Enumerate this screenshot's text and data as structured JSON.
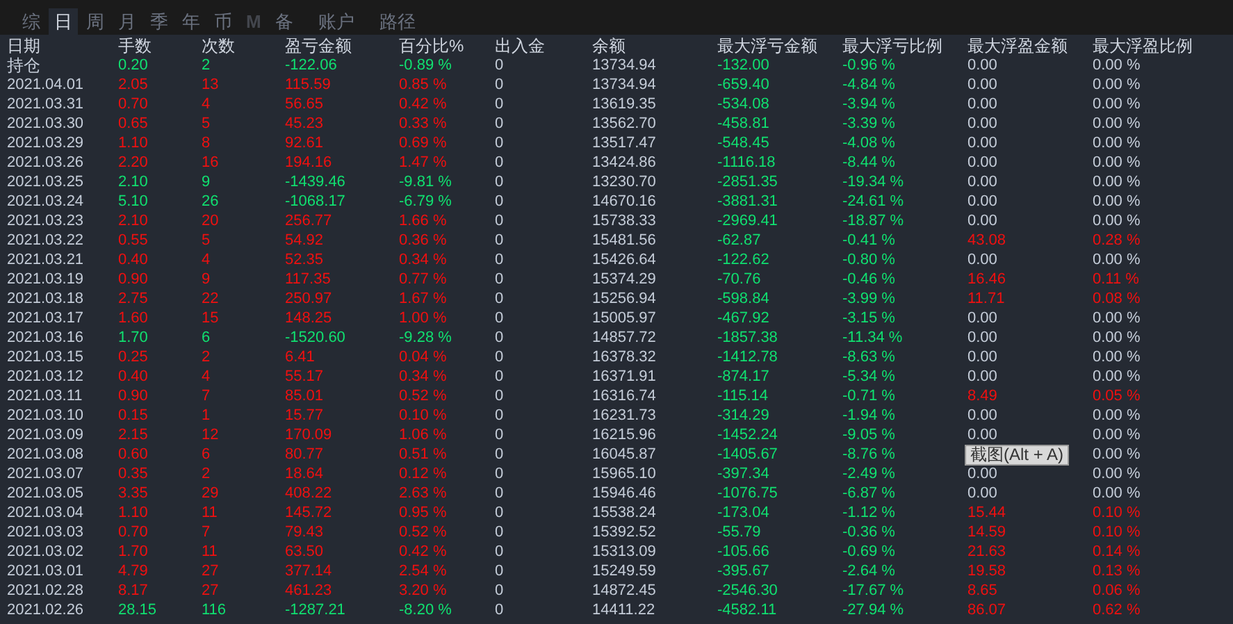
{
  "tabs": [
    {
      "label": "综",
      "selected": false,
      "disabled": false
    },
    {
      "label": "日",
      "selected": true,
      "disabled": false
    },
    {
      "label": "周",
      "selected": false,
      "disabled": false
    },
    {
      "label": "月",
      "selected": false,
      "disabled": false
    },
    {
      "label": "季",
      "selected": false,
      "disabled": false
    },
    {
      "label": "年",
      "selected": false,
      "disabled": false
    },
    {
      "label": "币",
      "selected": false,
      "disabled": false
    },
    {
      "label": "M",
      "selected": false,
      "disabled": true
    },
    {
      "label": "备",
      "selected": false,
      "disabled": false
    },
    {
      "label": "账户",
      "selected": false,
      "disabled": false
    },
    {
      "label": "路径",
      "selected": false,
      "disabled": false
    }
  ],
  "table": {
    "columns": [
      "日期",
      "手数",
      "次数",
      "盈亏金额",
      "百分比%",
      "出入金",
      "余额",
      "最大浮亏金额",
      "最大浮亏比例",
      "最大浮盈金额",
      "最大浮盈比例"
    ],
    "rows": [
      {
        "cells": [
          "持仓",
          "0.20",
          "2",
          "-122.06",
          "-0.89 %",
          "0",
          "13734.94",
          "-132.00",
          "-0.96 %",
          "0.00",
          "0.00 %"
        ],
        "loss": true,
        "float_gain": false
      },
      {
        "cells": [
          "2021.04.01",
          "2.05",
          "13",
          "115.59",
          "0.85 %",
          "0",
          "13734.94",
          "-659.40",
          "-4.84 %",
          "0.00",
          "0.00 %"
        ],
        "loss": false,
        "float_gain": false
      },
      {
        "cells": [
          "2021.03.31",
          "0.70",
          "4",
          "56.65",
          "0.42 %",
          "0",
          "13619.35",
          "-534.08",
          "-3.94 %",
          "0.00",
          "0.00 %"
        ],
        "loss": false,
        "float_gain": false
      },
      {
        "cells": [
          "2021.03.30",
          "0.65",
          "5",
          "45.23",
          "0.33 %",
          "0",
          "13562.70",
          "-458.81",
          "-3.39 %",
          "0.00",
          "0.00 %"
        ],
        "loss": false,
        "float_gain": false
      },
      {
        "cells": [
          "2021.03.29",
          "1.10",
          "8",
          "92.61",
          "0.69 %",
          "0",
          "13517.47",
          "-548.45",
          "-4.08 %",
          "0.00",
          "0.00 %"
        ],
        "loss": false,
        "float_gain": false
      },
      {
        "cells": [
          "2021.03.26",
          "2.20",
          "16",
          "194.16",
          "1.47 %",
          "0",
          "13424.86",
          "-1116.18",
          "-8.44 %",
          "0.00",
          "0.00 %"
        ],
        "loss": false,
        "float_gain": false
      },
      {
        "cells": [
          "2021.03.25",
          "2.10",
          "9",
          "-1439.46",
          "-9.81 %",
          "0",
          "13230.70",
          "-2851.35",
          "-19.34 %",
          "0.00",
          "0.00 %"
        ],
        "loss": true,
        "float_gain": false
      },
      {
        "cells": [
          "2021.03.24",
          "5.10",
          "26",
          "-1068.17",
          "-6.79 %",
          "0",
          "14670.16",
          "-3881.31",
          "-24.61 %",
          "0.00",
          "0.00 %"
        ],
        "loss": true,
        "float_gain": false
      },
      {
        "cells": [
          "2021.03.23",
          "2.10",
          "20",
          "256.77",
          "1.66 %",
          "0",
          "15738.33",
          "-2969.41",
          "-18.87 %",
          "0.00",
          "0.00 %"
        ],
        "loss": false,
        "float_gain": false
      },
      {
        "cells": [
          "2021.03.22",
          "0.55",
          "5",
          "54.92",
          "0.36 %",
          "0",
          "15481.56",
          "-62.87",
          "-0.41 %",
          "43.08",
          "0.28 %"
        ],
        "loss": false,
        "float_gain": true
      },
      {
        "cells": [
          "2021.03.21",
          "0.40",
          "4",
          "52.35",
          "0.34 %",
          "0",
          "15426.64",
          "-122.62",
          "-0.80 %",
          "0.00",
          "0.00 %"
        ],
        "loss": false,
        "float_gain": false
      },
      {
        "cells": [
          "2021.03.19",
          "0.90",
          "9",
          "117.35",
          "0.77 %",
          "0",
          "15374.29",
          "-70.76",
          "-0.46 %",
          "16.46",
          "0.11 %"
        ],
        "loss": false,
        "float_gain": true
      },
      {
        "cells": [
          "2021.03.18",
          "2.75",
          "22",
          "250.97",
          "1.67 %",
          "0",
          "15256.94",
          "-598.84",
          "-3.99 %",
          "11.71",
          "0.08 %"
        ],
        "loss": false,
        "float_gain": true
      },
      {
        "cells": [
          "2021.03.17",
          "1.60",
          "15",
          "148.25",
          "1.00 %",
          "0",
          "15005.97",
          "-467.92",
          "-3.15 %",
          "0.00",
          "0.00 %"
        ],
        "loss": false,
        "float_gain": false
      },
      {
        "cells": [
          "2021.03.16",
          "1.70",
          "6",
          "-1520.60",
          "-9.28 %",
          "0",
          "14857.72",
          "-1857.38",
          "-11.34 %",
          "0.00",
          "0.00 %"
        ],
        "loss": true,
        "float_gain": false
      },
      {
        "cells": [
          "2021.03.15",
          "0.25",
          "2",
          "6.41",
          "0.04 %",
          "0",
          "16378.32",
          "-1412.78",
          "-8.63 %",
          "0.00",
          "0.00 %"
        ],
        "loss": false,
        "float_gain": false
      },
      {
        "cells": [
          "2021.03.12",
          "0.40",
          "4",
          "55.17",
          "0.34 %",
          "0",
          "16371.91",
          "-874.17",
          "-5.34 %",
          "0.00",
          "0.00 %"
        ],
        "loss": false,
        "float_gain": false
      },
      {
        "cells": [
          "2021.03.11",
          "0.90",
          "7",
          "85.01",
          "0.52 %",
          "0",
          "16316.74",
          "-115.14",
          "-0.71 %",
          "8.49",
          "0.05 %"
        ],
        "loss": false,
        "float_gain": true
      },
      {
        "cells": [
          "2021.03.10",
          "0.15",
          "1",
          "15.77",
          "0.10 %",
          "0",
          "16231.73",
          "-314.29",
          "-1.94 %",
          "0.00",
          "0.00 %"
        ],
        "loss": false,
        "float_gain": false
      },
      {
        "cells": [
          "2021.03.09",
          "2.15",
          "12",
          "170.09",
          "1.06 %",
          "0",
          "16215.96",
          "-1452.24",
          "-9.05 %",
          "0.00",
          "0.00 %"
        ],
        "loss": false,
        "float_gain": false
      },
      {
        "cells": [
          "2021.03.08",
          "0.60",
          "6",
          "80.77",
          "0.51 %",
          "0",
          "16045.87",
          "-1405.67",
          "-8.76 %",
          null,
          "0.00 %"
        ],
        "loss": false,
        "float_gain": false
      },
      {
        "cells": [
          "2021.03.07",
          "0.35",
          "2",
          "18.64",
          "0.12 %",
          "0",
          "15965.10",
          "-397.34",
          "-2.49 %",
          "0.00",
          "0.00 %"
        ],
        "loss": false,
        "float_gain": false
      },
      {
        "cells": [
          "2021.03.05",
          "3.35",
          "29",
          "408.22",
          "2.63 %",
          "0",
          "15946.46",
          "-1076.75",
          "-6.87 %",
          "0.00",
          "0.00 %"
        ],
        "loss": false,
        "float_gain": false
      },
      {
        "cells": [
          "2021.03.04",
          "1.10",
          "11",
          "145.72",
          "0.95 %",
          "0",
          "15538.24",
          "-173.04",
          "-1.12 %",
          "15.44",
          "0.10 %"
        ],
        "loss": false,
        "float_gain": true
      },
      {
        "cells": [
          "2021.03.03",
          "0.70",
          "7",
          "79.43",
          "0.52 %",
          "0",
          "15392.52",
          "-55.79",
          "-0.36 %",
          "14.59",
          "0.10 %"
        ],
        "loss": false,
        "float_gain": true
      },
      {
        "cells": [
          "2021.03.02",
          "1.70",
          "11",
          "63.50",
          "0.42 %",
          "0",
          "15313.09",
          "-105.66",
          "-0.69 %",
          "21.63",
          "0.14 %"
        ],
        "loss": false,
        "float_gain": true
      },
      {
        "cells": [
          "2021.03.01",
          "4.79",
          "27",
          "377.14",
          "2.54 %",
          "0",
          "15249.59",
          "-395.67",
          "-2.64 %",
          "19.58",
          "0.13 %"
        ],
        "loss": false,
        "float_gain": true
      },
      {
        "cells": [
          "2021.02.28",
          "8.17",
          "27",
          "461.23",
          "3.20 %",
          "0",
          "14872.45",
          "-2546.30",
          "-17.67 %",
          "8.65",
          "0.06 %"
        ],
        "loss": false,
        "float_gain": true
      },
      {
        "cells": [
          "2021.02.26",
          "28.15",
          "116",
          "-1287.21",
          "-8.20 %",
          "0",
          "14411.22",
          "-4582.11",
          "-27.94 %",
          "86.07",
          "0.62 %"
        ],
        "loss": true,
        "float_gain": true
      }
    ]
  },
  "tooltip": "截图(Alt + A)"
}
